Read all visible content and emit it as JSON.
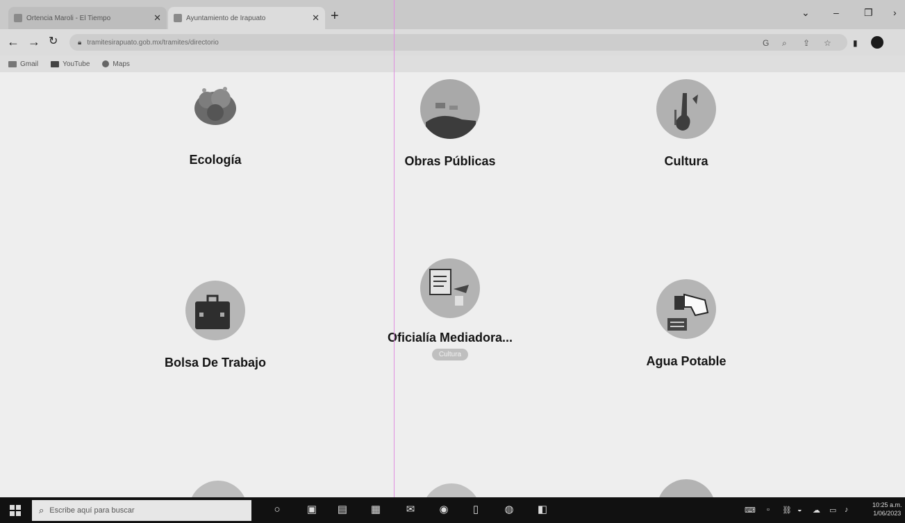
{
  "browser": {
    "tabs": [
      {
        "title": "Ortencia Maroli - El Tiempo",
        "active": false
      },
      {
        "title": "Ayuntamiento de Irapuato",
        "active": true
      }
    ],
    "new_tab": "+",
    "url": "tramitesirapuato.gob.mx/tramites/directorio",
    "bookmarks": [
      {
        "label": "Gmail"
      },
      {
        "label": "YouTube"
      },
      {
        "label": "Maps"
      }
    ]
  },
  "categories": [
    {
      "label": "Ecología",
      "icon": "plant-icon"
    },
    {
      "label": "Obras Públicas",
      "icon": "construction-icon"
    },
    {
      "label": "Cultura",
      "icon": "guitar-icon"
    },
    {
      "label": "Bolsa De Trabajo",
      "icon": "briefcase-icon"
    },
    {
      "label": "Oficialía Mediadora...",
      "icon": "document-icon",
      "badge": "Cultura"
    },
    {
      "label": "Agua Potable",
      "icon": "water-tap-icon"
    }
  ],
  "taskbar": {
    "search_placeholder": "Escribe aquí para buscar",
    "time": "10:25 a.m.",
    "date": "1/06/2023"
  },
  "colors": {
    "page_background": "#eeeeee",
    "chrome_background": "#c9c9c9",
    "taskbar": "#111111",
    "guide_line": "#e08ee0"
  }
}
